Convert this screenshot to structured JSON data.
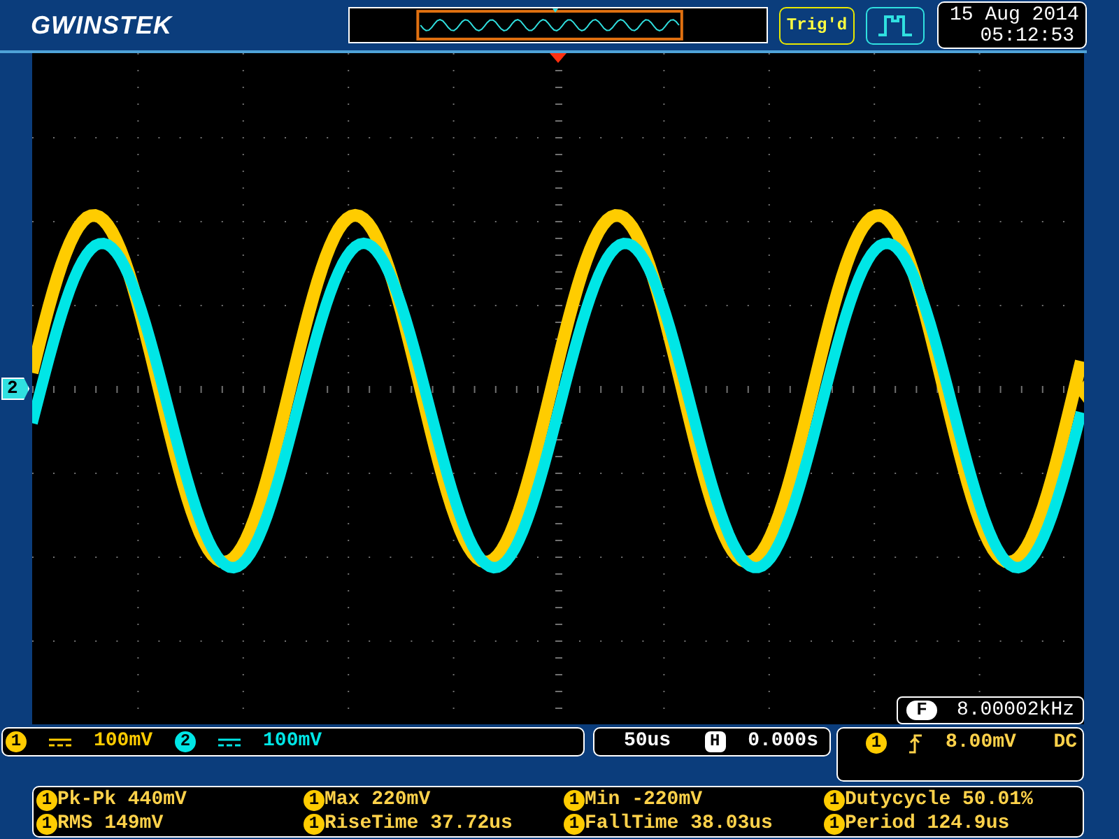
{
  "header": {
    "logo": "GWINSTEK",
    "trigger_status": "Trig'd",
    "date": "15 Aug 2014",
    "time": "05:12:53"
  },
  "screen": {
    "channel_marker": "2",
    "frequency": {
      "badge": "F",
      "value": "8.00002kHz"
    }
  },
  "channels": [
    {
      "number": "1",
      "scale": "100mV",
      "color": "#ffcc00"
    },
    {
      "number": "2",
      "scale": "100mV",
      "color": "#00e6e6"
    }
  ],
  "timebase": {
    "scale": "50us",
    "position_badge": "H",
    "position": "0.000s"
  },
  "trigger": {
    "source": "1",
    "level": "8.00mV",
    "coupling": "DC"
  },
  "measurements": [
    {
      "channel": "1",
      "text": "Pk-Pk 440mV"
    },
    {
      "channel": "1",
      "text": "Max 220mV"
    },
    {
      "channel": "1",
      "text": "Min -220mV"
    },
    {
      "channel": "1",
      "text": "Dutycycle 50.01%"
    },
    {
      "channel": "1",
      "text": "RMS 149mV"
    },
    {
      "channel": "1",
      "text": "RiseTime 37.72us"
    },
    {
      "channel": "1",
      "text": "FallTime 38.03us"
    },
    {
      "channel": "1",
      "text": "Period 124.9us"
    }
  ]
}
